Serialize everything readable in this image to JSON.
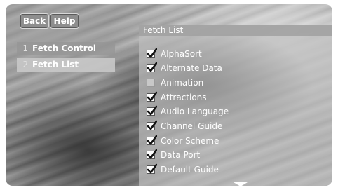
{
  "buttons": {
    "back": "Back",
    "help": "Help"
  },
  "menu": [
    {
      "num": "1",
      "label": "Fetch Control"
    },
    {
      "num": "2",
      "label": "Fetch List"
    }
  ],
  "panel": {
    "title": "Fetch List",
    "options": [
      {
        "label": "AlphaSort",
        "checked": true
      },
      {
        "label": "Alternate Data",
        "checked": true
      },
      {
        "label": "Animation",
        "checked": false
      },
      {
        "label": "Attractions",
        "checked": true
      },
      {
        "label": "Audio Language",
        "checked": true
      },
      {
        "label": "Channel Guide",
        "checked": true
      },
      {
        "label": "Color Scheme",
        "checked": true
      },
      {
        "label": "Data Port",
        "checked": true
      },
      {
        "label": "Default Guide",
        "checked": true
      }
    ]
  }
}
